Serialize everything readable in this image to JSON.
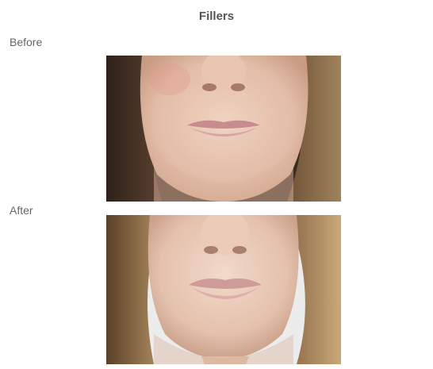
{
  "page": {
    "title": "Fillers"
  },
  "sections": {
    "before": {
      "label": "Before"
    },
    "after": {
      "label": "After"
    }
  },
  "colors": {
    "skin": "#e8c8b4",
    "skin_shadow": "#d9ad96",
    "hair_dark": "#3a2a20",
    "hair_light": "#8a6a4a",
    "lips": "#d49a9c",
    "background_wall": "#f2f2f2"
  }
}
